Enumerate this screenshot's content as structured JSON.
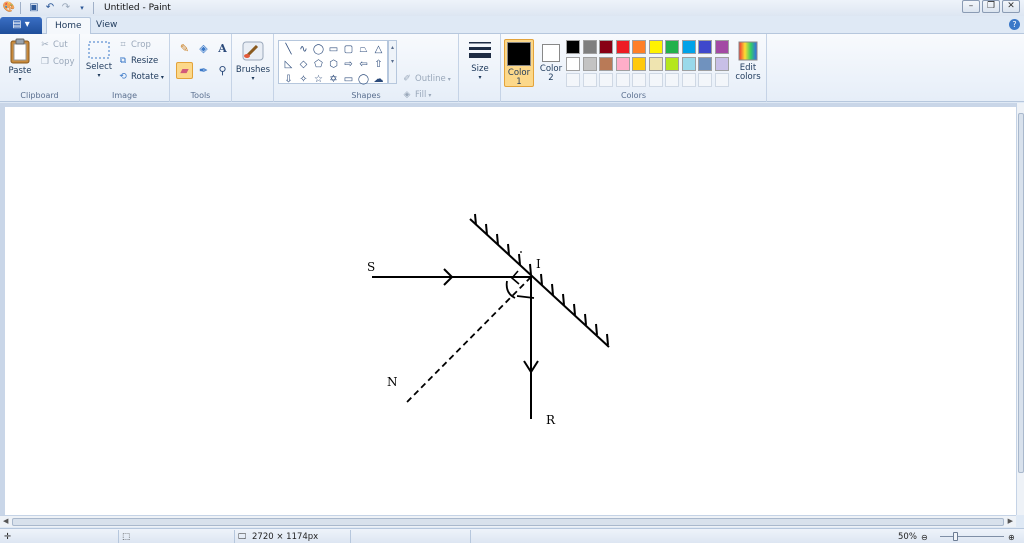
{
  "window": {
    "title": "Untitled - Paint"
  },
  "tabs": {
    "file_icon": "menu-icon",
    "home": "Home",
    "view": "View"
  },
  "ribbon": {
    "clipboard": {
      "paste": "Paste",
      "cut": "Cut",
      "copy": "Copy",
      "label": "Clipboard"
    },
    "image": {
      "select": "Select",
      "crop": "Crop",
      "resize": "Resize",
      "rotate": "Rotate",
      "label": "Image"
    },
    "tools": {
      "label": "Tools",
      "selected_tool": "eraser"
    },
    "brushes": {
      "label": "Brushes"
    },
    "shapes": {
      "outline": "Outline",
      "fill": "Fill",
      "label": "Shapes"
    },
    "size": {
      "label": "Size"
    },
    "colors": {
      "color1_label": "Color\n1",
      "color2_label": "Color\n2",
      "color1_value": "#000000",
      "color2_value": "#ffffff",
      "edit_label": "Edit colors",
      "label": "Colors",
      "palette": [
        "#000000",
        "#7f7f7f",
        "#880015",
        "#ed1c24",
        "#ff7f27",
        "#fff200",
        "#22b14c",
        "#00a2e8",
        "#3f48cc",
        "#a349a4",
        "#ffffff",
        "#c3c3c3",
        "#b97a57",
        "#ffaec9",
        "#ffc90e",
        "#efe4b0",
        "#b5e61d",
        "#99d9ea",
        "#7092be",
        "#c8bfe7"
      ]
    }
  },
  "drawing": {
    "labels": {
      "s": "S",
      "i": "I",
      "n": "N",
      "r": "R"
    }
  },
  "status": {
    "image_size": "2720 × 1174px",
    "zoom": "50%"
  }
}
